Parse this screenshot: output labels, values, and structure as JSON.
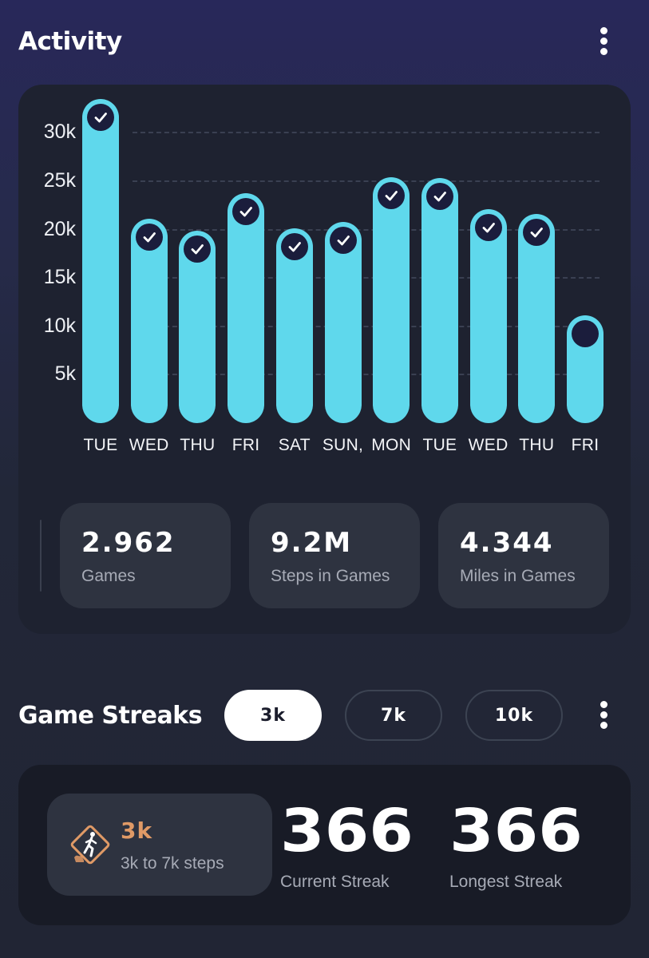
{
  "header": {
    "title": "Activity"
  },
  "chart_data": {
    "type": "bar",
    "categories": [
      "TUE",
      "WED",
      "THU",
      "FRI",
      "SAT",
      "SUN,",
      "MON",
      "TUE",
      "WED",
      "THU",
      "FRI"
    ],
    "values": [
      33500,
      21100,
      19900,
      23800,
      20100,
      20800,
      25400,
      25300,
      22100,
      21600,
      11100
    ],
    "goal_met": [
      true,
      true,
      true,
      true,
      true,
      true,
      true,
      true,
      true,
      true,
      false
    ],
    "y_tick_labels": [
      "30k",
      "25k",
      "20k",
      "15k",
      "10k",
      "5k"
    ],
    "y_ticks": [
      30000,
      25000,
      20000,
      15000,
      10000,
      5000
    ],
    "ylim": [
      0,
      33500
    ],
    "bar_color": "#5fd8ec",
    "grid": true
  },
  "stats": [
    {
      "value": "2.962",
      "label": "Games"
    },
    {
      "value": "9.2M",
      "label": "Steps in Games"
    },
    {
      "value": "4.344",
      "label": "Miles in Games"
    }
  ],
  "streaks": {
    "title": "Game Streaks",
    "tabs": [
      {
        "label": "3k",
        "active": true
      },
      {
        "label": "7k",
        "active": false
      },
      {
        "label": "10k",
        "active": false
      }
    ],
    "level": {
      "name": "3k",
      "range": "3k to 7k steps",
      "color": "#e09a66"
    },
    "current_value": "366",
    "current_label": "Current Streak",
    "longest_value": "366",
    "longest_label": "Longest Streak"
  },
  "icons": [
    "more-vertical-icon",
    "check-icon",
    "walking-person-sign-icon"
  ]
}
